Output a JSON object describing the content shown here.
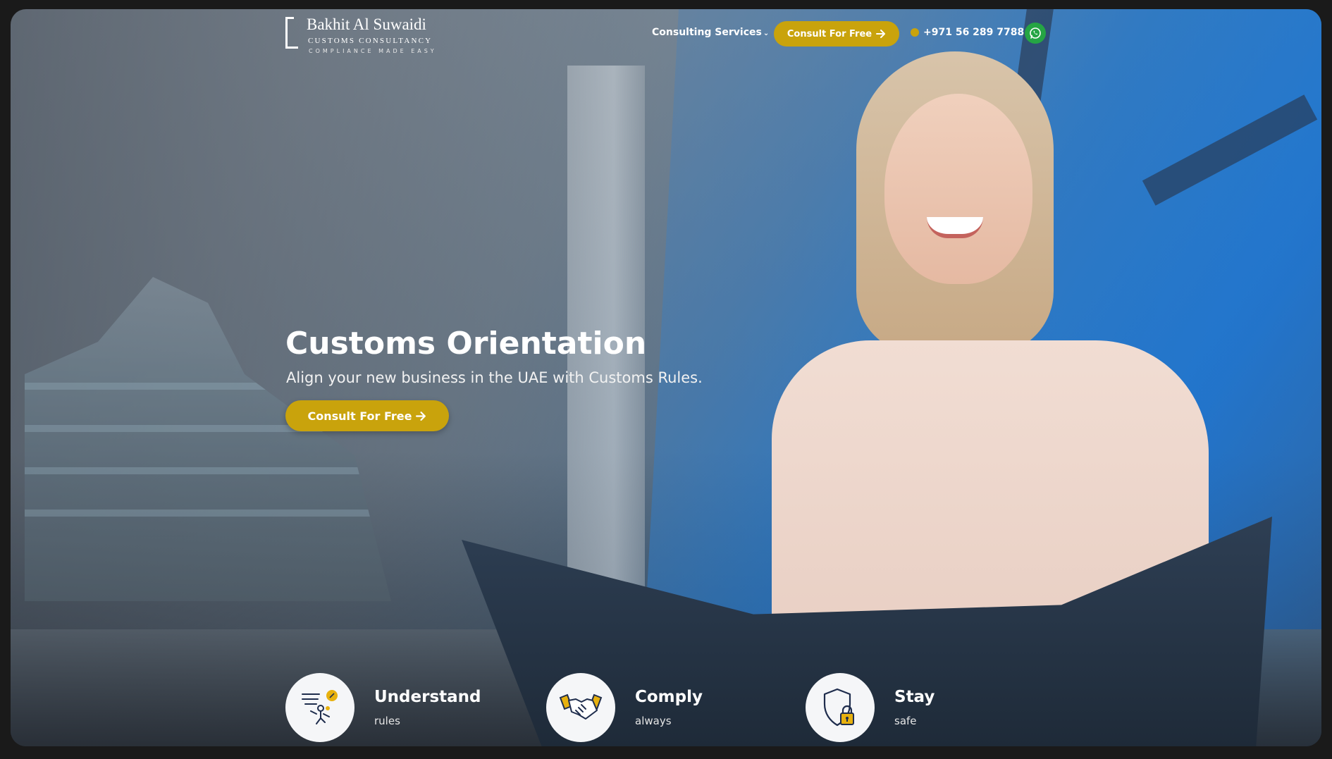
{
  "brand": {
    "name": "Bakhit Al Suwaidi",
    "subtitle": "CUSTOMS CONSULTANCY",
    "tagline": "COMPLIANCE MADE EASY"
  },
  "nav": {
    "services_label": "Consulting Services",
    "cta_label": "Consult For Free",
    "phone": "+971 56 289 7788"
  },
  "hero": {
    "title": "Customs Orientation",
    "subtitle": "Align your new business in the UAE with Customs Rules.",
    "cta_label": "Consult For Free"
  },
  "features": [
    {
      "title": "Understand",
      "subtitle": "rules",
      "icon": "understand-rules-icon"
    },
    {
      "title": "Comply",
      "subtitle": "always",
      "icon": "handshake-icon"
    },
    {
      "title": "Stay",
      "subtitle": "safe",
      "icon": "shield-lock-icon"
    }
  ],
  "colors": {
    "accent": "#c9a30c",
    "whatsapp": "#25a544",
    "icon_navy": "#1f2d4d"
  }
}
